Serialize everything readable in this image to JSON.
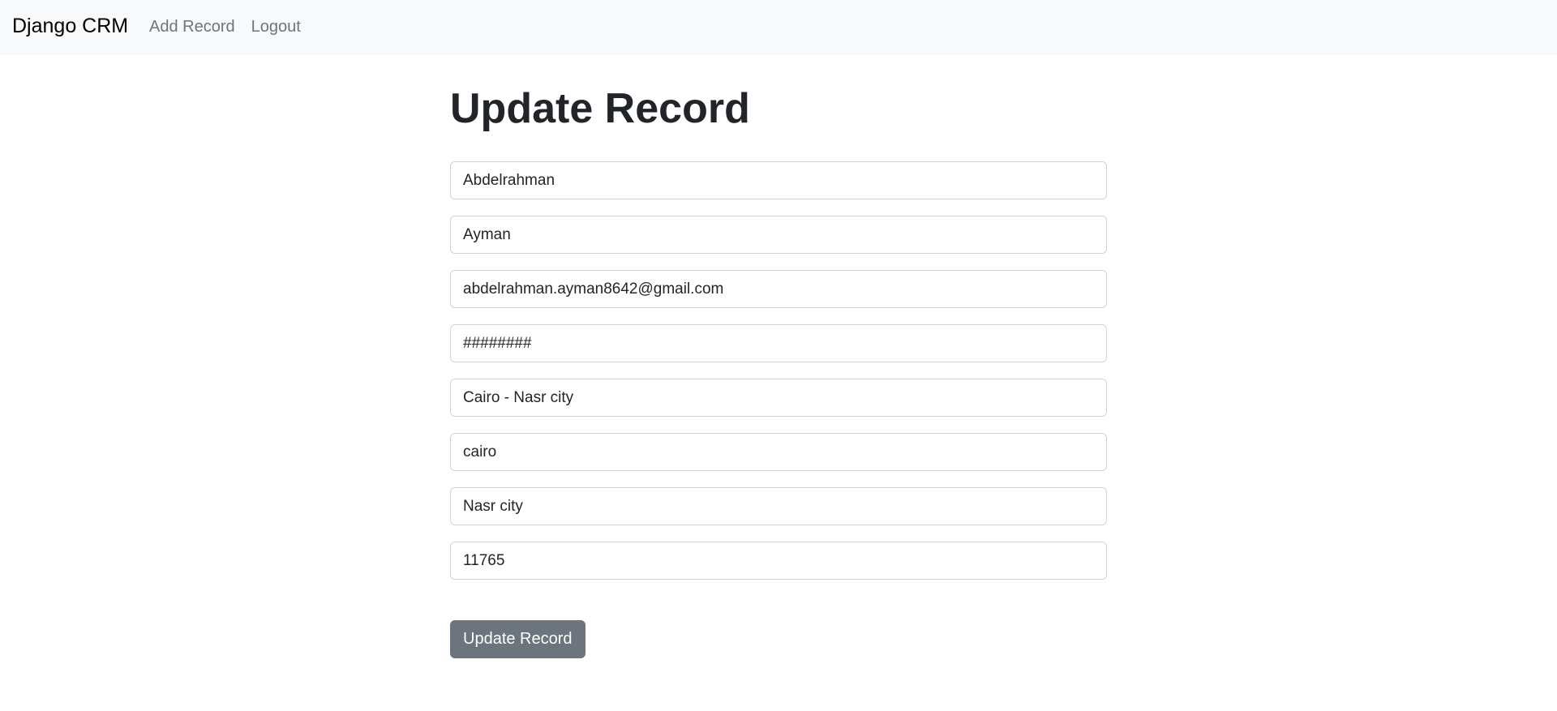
{
  "navbar": {
    "brand": "Django CRM",
    "links": [
      "Add Record",
      "Logout"
    ]
  },
  "page": {
    "title": "Update Record"
  },
  "form": {
    "fields": [
      {
        "name": "first_name",
        "value": "Abdelrahman"
      },
      {
        "name": "last_name",
        "value": "Ayman"
      },
      {
        "name": "email",
        "value": "abdelrahman.ayman8642@gmail.com"
      },
      {
        "name": "phone",
        "value": "########"
      },
      {
        "name": "address",
        "value": "Cairo - Nasr city"
      },
      {
        "name": "city",
        "value": "cairo"
      },
      {
        "name": "state",
        "value": "Nasr city"
      },
      {
        "name": "zipcode",
        "value": "11765"
      }
    ],
    "submit_label": "Update Record"
  },
  "colors": {
    "navbar_bg": "#f8f9fa",
    "nav_link": "#6c757d",
    "button_bg": "#6c757d",
    "input_border": "#ced4da",
    "text": "#212529"
  }
}
